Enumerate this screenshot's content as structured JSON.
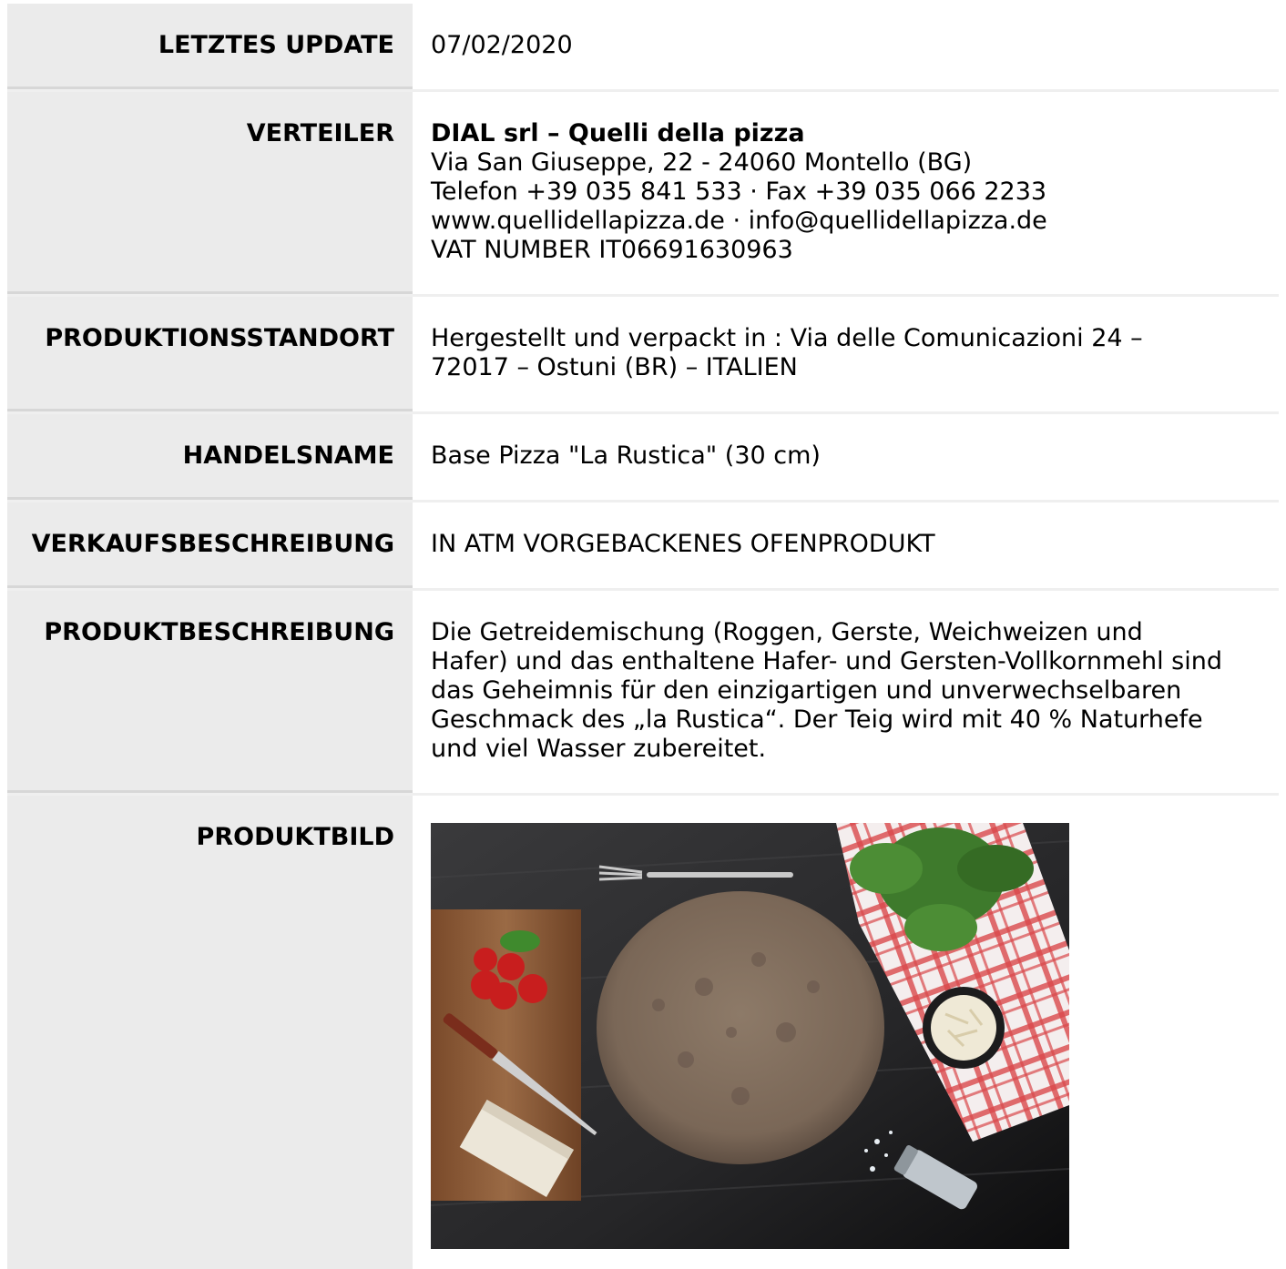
{
  "rows": {
    "update": {
      "label": "LETZTES UPDATE",
      "value": "07/02/2020"
    },
    "distributor": {
      "label": "VERTEILER",
      "company": "DIAL srl – Quelli della pizza",
      "address": "Via San Giuseppe, 22 - 24060 Montello (BG)",
      "phone": "Telefon +39 035 841 533 · Fax +39 035 066 2233",
      "web": "www.quellidellapizza.de · info@quellidellapizza.de",
      "vat": "VAT NUMBER IT06691630963"
    },
    "production": {
      "label": "PRODUKTIONSSTANDORT",
      "line1": "Hergestellt und verpackt in : Via delle Comunicazioni 24 –",
      "line2": "72017 – Ostuni (BR) – ITALIEN"
    },
    "tradename": {
      "label": "HANDELSNAME",
      "value": "Base Pizza \"La Rustica\" (30 cm)"
    },
    "sales": {
      "label": "VERKAUFSBESCHREIBUNG",
      "value": "IN ATM VORGEBACKENES OFENPRODUKT"
    },
    "description": {
      "label": "PRODUKTBESCHREIBUNG",
      "lines": [
        "Die Getreidemischung (Roggen, Gerste, Weichweizen und",
        "Hafer) und das enthaltene Hafer- und Gersten-Vollkornmehl sind",
        "das Geheimnis für den einzigartigen und unverwechselbaren",
        "Geschmack des „la Rustica“. Der Teig wird mit 40 % Naturhefe",
        "und viel Wasser zubereitet."
      ]
    },
    "image": {
      "label": "PRODUKTBILD"
    }
  }
}
